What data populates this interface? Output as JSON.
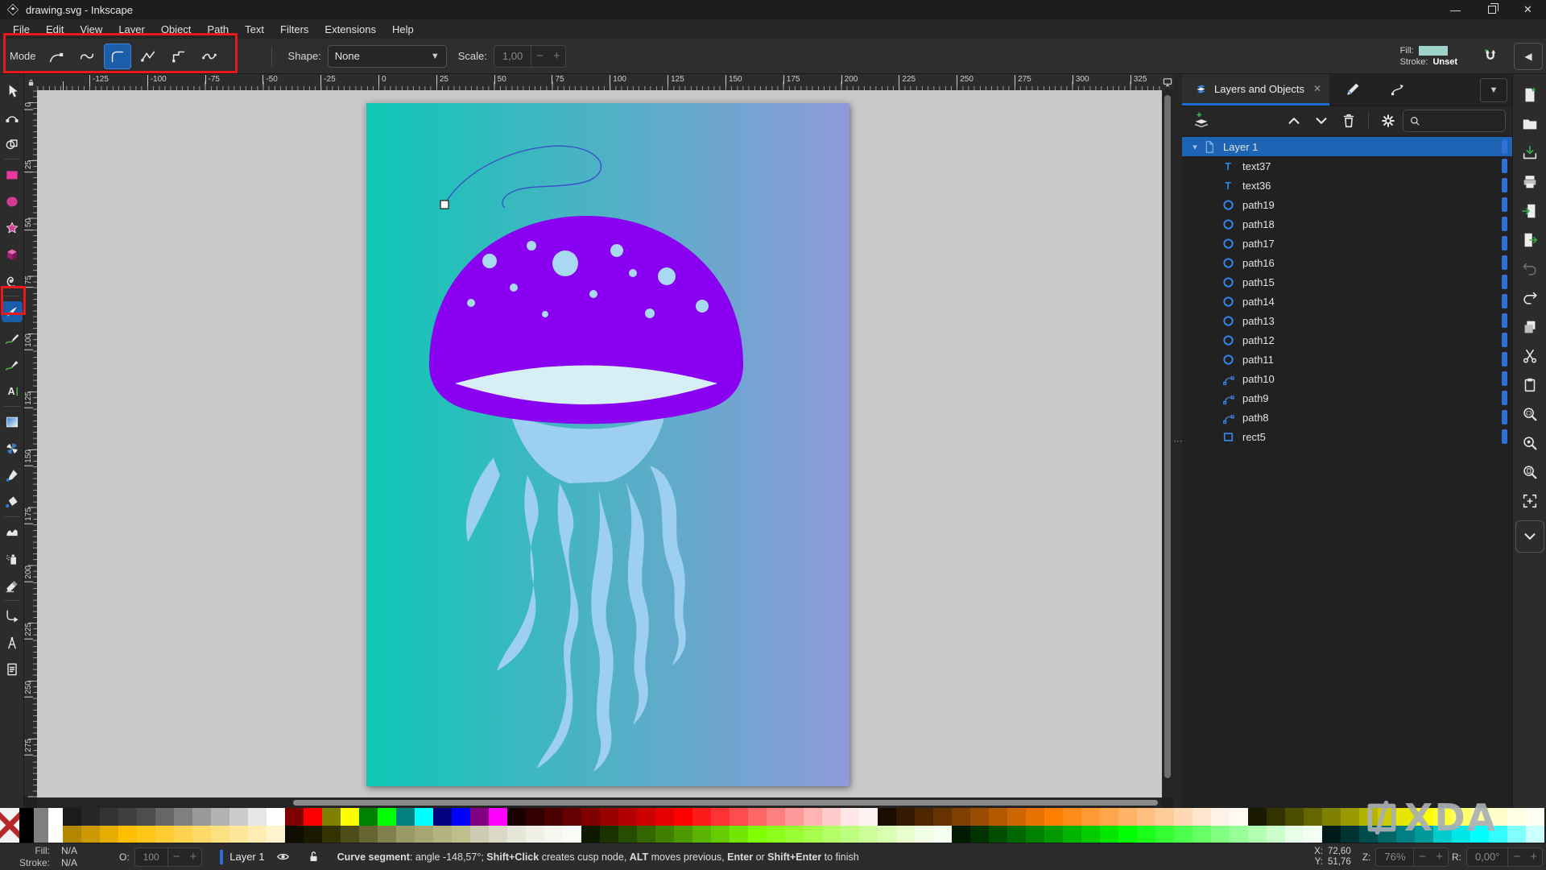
{
  "window": {
    "title": "drawing.svg - Inkscape",
    "minimize_glyph": "—",
    "close_glyph": "✕"
  },
  "menu": {
    "items": [
      "File",
      "Edit",
      "View",
      "Layer",
      "Object",
      "Path",
      "Text",
      "Filters",
      "Extensions",
      "Help"
    ]
  },
  "tool_options": {
    "mode_label": "Mode",
    "modes": [
      {
        "icon": "mode-bezier",
        "name": "mode-regular-bezier-button"
      },
      {
        "icon": "mode-spiro",
        "name": "mode-spiro-button"
      },
      {
        "icon": "mode-bspline",
        "name": "mode-bspline-button",
        "sel": true
      },
      {
        "icon": "mode-straight",
        "name": "mode-straight-segments-button"
      },
      {
        "icon": "mode-paraxial",
        "name": "mode-paraxial-segments-button"
      },
      {
        "icon": "mode-lpe",
        "name": "mode-flatten-spiro-button",
        "after_sep": true
      }
    ],
    "shape_label": "Shape:",
    "shape_value": "None",
    "dropdown_glyph": "▼",
    "scale_label": "Scale:",
    "scale_value": "1,00",
    "minus_glyph": "−",
    "plus_glyph": "+",
    "fill_label": "Fill:",
    "fill_color": "#9fd4ca",
    "stroke_label": "Stroke:",
    "stroke_value": "Unset",
    "collapse_glyph": "◀"
  },
  "toolbox": {
    "tools": [
      {
        "icon": "cursor",
        "name": "selector-tool"
      },
      {
        "icon": "nodes",
        "name": "node-editor-tool"
      },
      {
        "icon": "builder",
        "name": "shape-builder-tool",
        "sep_after": true
      },
      {
        "icon": "rect",
        "name": "rectangle-tool"
      },
      {
        "icon": "ellipse",
        "name": "ellipse-tool"
      },
      {
        "icon": "star",
        "name": "star-tool"
      },
      {
        "icon": "box",
        "name": "box-3d-tool"
      },
      {
        "icon": "spiral",
        "name": "spiral-tool",
        "sep_after": true
      },
      {
        "icon": "pen",
        "name": "pen-bezier-tool",
        "sel": true
      },
      {
        "icon": "pencil",
        "name": "pencil-tool"
      },
      {
        "icon": "brush",
        "name": "calligraphy-tool"
      },
      {
        "icon": "text",
        "name": "text-tool",
        "sep_after": true
      },
      {
        "icon": "grad",
        "name": "gradient-tool"
      },
      {
        "icon": "mesh",
        "name": "mesh-gradient-tool"
      },
      {
        "icon": "drop",
        "name": "dropper-tool"
      },
      {
        "icon": "bucket",
        "name": "paint-bucket-tool",
        "sep_after": true
      },
      {
        "icon": "tweak",
        "name": "tweak-tool"
      },
      {
        "icon": "spray",
        "name": "spray-tool"
      },
      {
        "icon": "eraser",
        "name": "eraser-tool",
        "sep_after": true
      },
      {
        "icon": "conn",
        "name": "connector-tool"
      },
      {
        "icon": "measure",
        "name": "measure-tool"
      },
      {
        "icon": "doc",
        "name": "xml-editor-tool"
      }
    ]
  },
  "rulers": {
    "h_labels": [
      -125,
      -100,
      -75,
      -50,
      -25,
      0,
      25,
      50,
      75,
      100,
      125,
      150,
      175,
      200,
      225,
      250,
      275,
      300,
      325
    ],
    "v_labels": [
      0,
      25,
      50,
      75,
      100,
      125,
      150,
      175,
      200,
      225,
      250,
      275
    ]
  },
  "canvas": {
    "colors": {
      "bg_left": "#0fc7b5",
      "bg_mid": "#57aec8",
      "bg_right": "#8f9ad9",
      "cap": "#8a00f0",
      "crescent": "#d8eef7",
      "spots": "#a9d9f2",
      "tentacles": "#9ccff0",
      "pen_curve": "#3a51c8"
    }
  },
  "dock": {
    "active_tab": "Layers and Objects",
    "tab_close_glyph": "✕",
    "chevron_glyph": "▼",
    "search_placeholder": "",
    "layers": [
      {
        "icon": "li-layer",
        "label": "Layer 1",
        "sel": true,
        "exp": "▾"
      },
      {
        "icon": "li-text",
        "label": "text37",
        "child": true
      },
      {
        "icon": "li-text",
        "label": "text36",
        "child": true
      },
      {
        "icon": "li-circle",
        "label": "path19",
        "child": true
      },
      {
        "icon": "li-circle",
        "label": "path18",
        "child": true
      },
      {
        "icon": "li-circle",
        "label": "path17",
        "child": true
      },
      {
        "icon": "li-circle",
        "label": "path16",
        "child": true
      },
      {
        "icon": "li-circle",
        "label": "path15",
        "child": true
      },
      {
        "icon": "li-circle",
        "label": "path14",
        "child": true
      },
      {
        "icon": "li-circle",
        "label": "path13",
        "child": true
      },
      {
        "icon": "li-circle",
        "label": "path12",
        "child": true
      },
      {
        "icon": "li-circle",
        "label": "path11",
        "child": true
      },
      {
        "icon": "li-bezier",
        "label": "path10",
        "child": true
      },
      {
        "icon": "li-bezier",
        "label": "path9",
        "child": true
      },
      {
        "icon": "li-bezier",
        "label": "path8",
        "child": true
      },
      {
        "icon": "li-rect",
        "label": "rect5",
        "child": true
      }
    ]
  },
  "commands": [
    {
      "icon": "new",
      "name": "new-document-button"
    },
    {
      "icon": "open",
      "name": "open-document-button"
    },
    {
      "icon": "save",
      "name": "save-button"
    },
    {
      "icon": "print",
      "name": "print-button"
    },
    {
      "icon": "import",
      "name": "import-button"
    },
    {
      "icon": "export",
      "name": "export-button"
    },
    {
      "icon": "undo",
      "name": "undo-button",
      "dis": true
    },
    {
      "icon": "redo",
      "name": "redo-button"
    },
    {
      "icon": "copy",
      "name": "copy-button"
    },
    {
      "icon": "cut",
      "name": "cut-button"
    },
    {
      "icon": "paste",
      "name": "paste-button"
    },
    {
      "icon": "zoomsel",
      "name": "zoom-selection-button"
    },
    {
      "icon": "zoomdraw",
      "name": "zoom-drawing-button"
    },
    {
      "icon": "zoompage",
      "name": "zoom-page-button"
    },
    {
      "icon": "frame",
      "name": "zoom-center-page-button"
    }
  ],
  "palette": {
    "row1": [
      "#1b1b1b",
      "#262626",
      "#333333",
      "#404040",
      "#4d4d4d",
      "#666666",
      "#808080",
      "#999999",
      "#b3b3b3",
      "#cccccc",
      "#e6e6e6",
      "#ffffff",
      "#800000",
      "#ff0000",
      "#808000",
      "#ffff00",
      "#008000",
      "#00ff00",
      "#008080",
      "#00ffff",
      "#000080",
      "#0000ff",
      "#800080",
      "#ff00ff",
      "#1a0000",
      "#330000",
      "#4d0000",
      "#660000",
      "#800000",
      "#990000",
      "#b30000",
      "#cc0000",
      "#e60000",
      "#ff0000",
      "#ff1a1a",
      "#ff3333",
      "#ff4d4d",
      "#ff6666",
      "#ff8080",
      "#ff9999",
      "#ffb3b3",
      "#ffcccc",
      "#ffe6e6",
      "#fff2f2",
      "#1a0d00",
      "#331a00",
      "#4d2600",
      "#663300",
      "#804000",
      "#994d00",
      "#b35900",
      "#cc6600",
      "#e67300",
      "#ff8000",
      "#ff8c1a",
      "#ff9933",
      "#ffa64d",
      "#ffb366",
      "#ffbf80",
      "#ffcc99",
      "#ffd9b3",
      "#ffe6cc",
      "#fff2e6",
      "#fff9f2",
      "#1a1a00",
      "#333300",
      "#4d4d00",
      "#666600",
      "#808000",
      "#999900",
      "#b3b300",
      "#cccc00",
      "#e6e600",
      "#ffff00",
      "#ffff33",
      "#ffff66",
      "#ffff99",
      "#ffffcc",
      "#ffffe6",
      "#fffff2"
    ],
    "row2": [
      "#b38600",
      "#cc9900",
      "#e6ac00",
      "#ffbf00",
      "#ffc61a",
      "#ffcc33",
      "#ffd34d",
      "#ffd966",
      "#ffe080",
      "#ffe699",
      "#ffedb3",
      "#fff4cc",
      "#0d0d00",
      "#1a1a00",
      "#333300",
      "#4d4d1a",
      "#666633",
      "#80804d",
      "#999966",
      "#a6a673",
      "#b3b380",
      "#bfbf8c",
      "#ccccb3",
      "#d9d9c6",
      "#e6e6d9",
      "#f0f0e6",
      "#f7f7f0",
      "#fbfbf7",
      "#0d1a00",
      "#1a3300",
      "#264d00",
      "#336600",
      "#408000",
      "#4d9900",
      "#59b300",
      "#66cc00",
      "#73e600",
      "#80ff00",
      "#8cff1a",
      "#99ff33",
      "#a6ff4d",
      "#b3ff66",
      "#bfff80",
      "#ccff99",
      "#d9ffb3",
      "#e6ffcc",
      "#f0ffe6",
      "#f7fff2",
      "#001a00",
      "#003300",
      "#004d00",
      "#006600",
      "#008000",
      "#009900",
      "#00b300",
      "#00cc00",
      "#00e600",
      "#00ff00",
      "#1aff1a",
      "#33ff33",
      "#4dff4d",
      "#66ff66",
      "#80ff80",
      "#99ff99",
      "#b3ffb3",
      "#ccffcc",
      "#e6ffe6",
      "#f2fff2",
      "#001a1a",
      "#003333",
      "#004d4d",
      "#006666",
      "#008080",
      "#009999",
      "#00cccc",
      "#00e6e6",
      "#00ffff",
      "#33ffff",
      "#80ffff",
      "#ccffff"
    ]
  },
  "status": {
    "fill_label": "Fill:",
    "fill_value": "N/A",
    "stroke_label": "Stroke:",
    "stroke_value": "N/A",
    "opacity_label": "O:",
    "opacity_value": "100",
    "layer_label": "Layer 1",
    "message_parts": [
      {
        "t": "Curve segment",
        "b": true
      },
      {
        "t": ": angle -148,57°; ",
        "b": false
      },
      {
        "t": "Shift+Click",
        "b": true
      },
      {
        "t": " creates cusp node, ",
        "b": false
      },
      {
        "t": "ALT",
        "b": true
      },
      {
        "t": " moves previous, ",
        "b": false
      },
      {
        "t": "Enter",
        "b": true
      },
      {
        "t": " or ",
        "b": false
      },
      {
        "t": "Shift+Enter",
        "b": true
      },
      {
        "t": " to finish",
        "b": false
      }
    ],
    "x_label": "X:",
    "x_value": "72,60",
    "y_label": "Y:",
    "y_value": "51,76",
    "z_label": "Z:",
    "z_value": "76%",
    "r_label": "R:",
    "r_value": "0,00°"
  },
  "watermark": {
    "text": "XDA"
  }
}
